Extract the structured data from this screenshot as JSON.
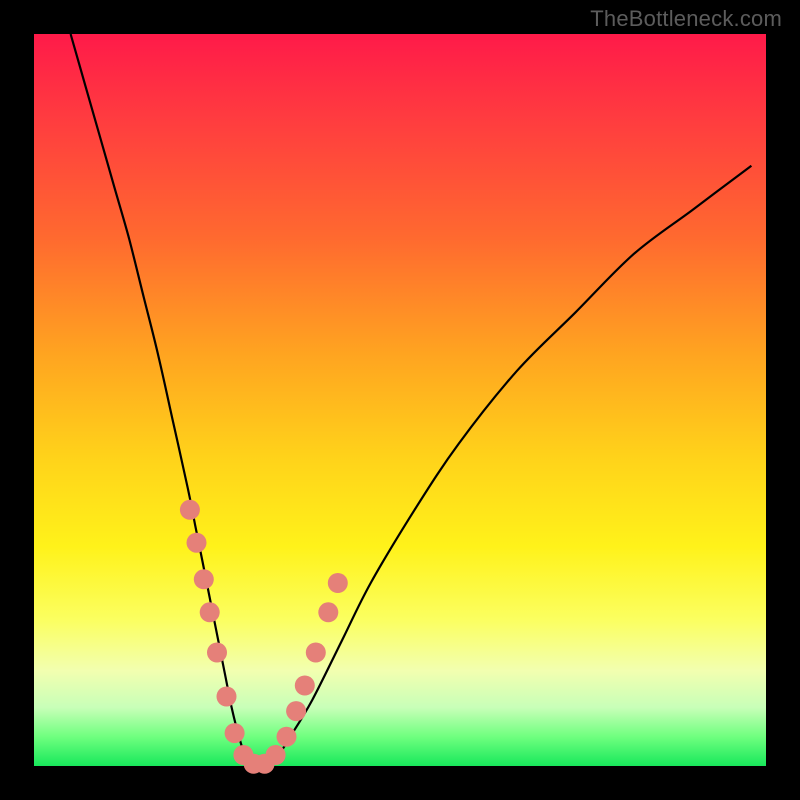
{
  "watermark": "TheBottleneck.com",
  "colors": {
    "curve": "#000000",
    "marker_fill": "#e58079",
    "marker_stroke": "#c76a63",
    "frame": "#000000"
  },
  "chart_data": {
    "type": "line",
    "title": "",
    "xlabel": "",
    "ylabel": "",
    "xlim": [
      0,
      100
    ],
    "ylim": [
      0,
      100
    ],
    "series": [
      {
        "name": "bottleneck-curve",
        "x": [
          5,
          7,
          9,
          11,
          13,
          15,
          17,
          19,
          21,
          22,
          23,
          24,
          25,
          26,
          27,
          28,
          29,
          30,
          31,
          33,
          35,
          38,
          42,
          46,
          52,
          58,
          66,
          74,
          82,
          90,
          98
        ],
        "y": [
          100,
          93,
          86,
          79,
          72,
          64,
          56,
          47,
          38,
          33,
          28,
          23,
          18,
          13,
          8,
          4,
          1,
          0,
          0,
          1,
          4,
          9,
          17,
          25,
          35,
          44,
          54,
          62,
          70,
          76,
          82
        ]
      }
    ],
    "markers": {
      "name": "highlighted-points",
      "x": [
        21.3,
        22.2,
        23.2,
        24.0,
        25.0,
        26.3,
        27.4,
        28.6,
        30.0,
        31.5,
        33.0,
        34.5,
        35.8,
        37.0,
        38.5,
        40.2,
        41.5
      ],
      "y": [
        35.0,
        30.5,
        25.5,
        21.0,
        15.5,
        9.5,
        4.5,
        1.5,
        0.3,
        0.3,
        1.5,
        4.0,
        7.5,
        11.0,
        15.5,
        21.0,
        25.0
      ]
    }
  }
}
